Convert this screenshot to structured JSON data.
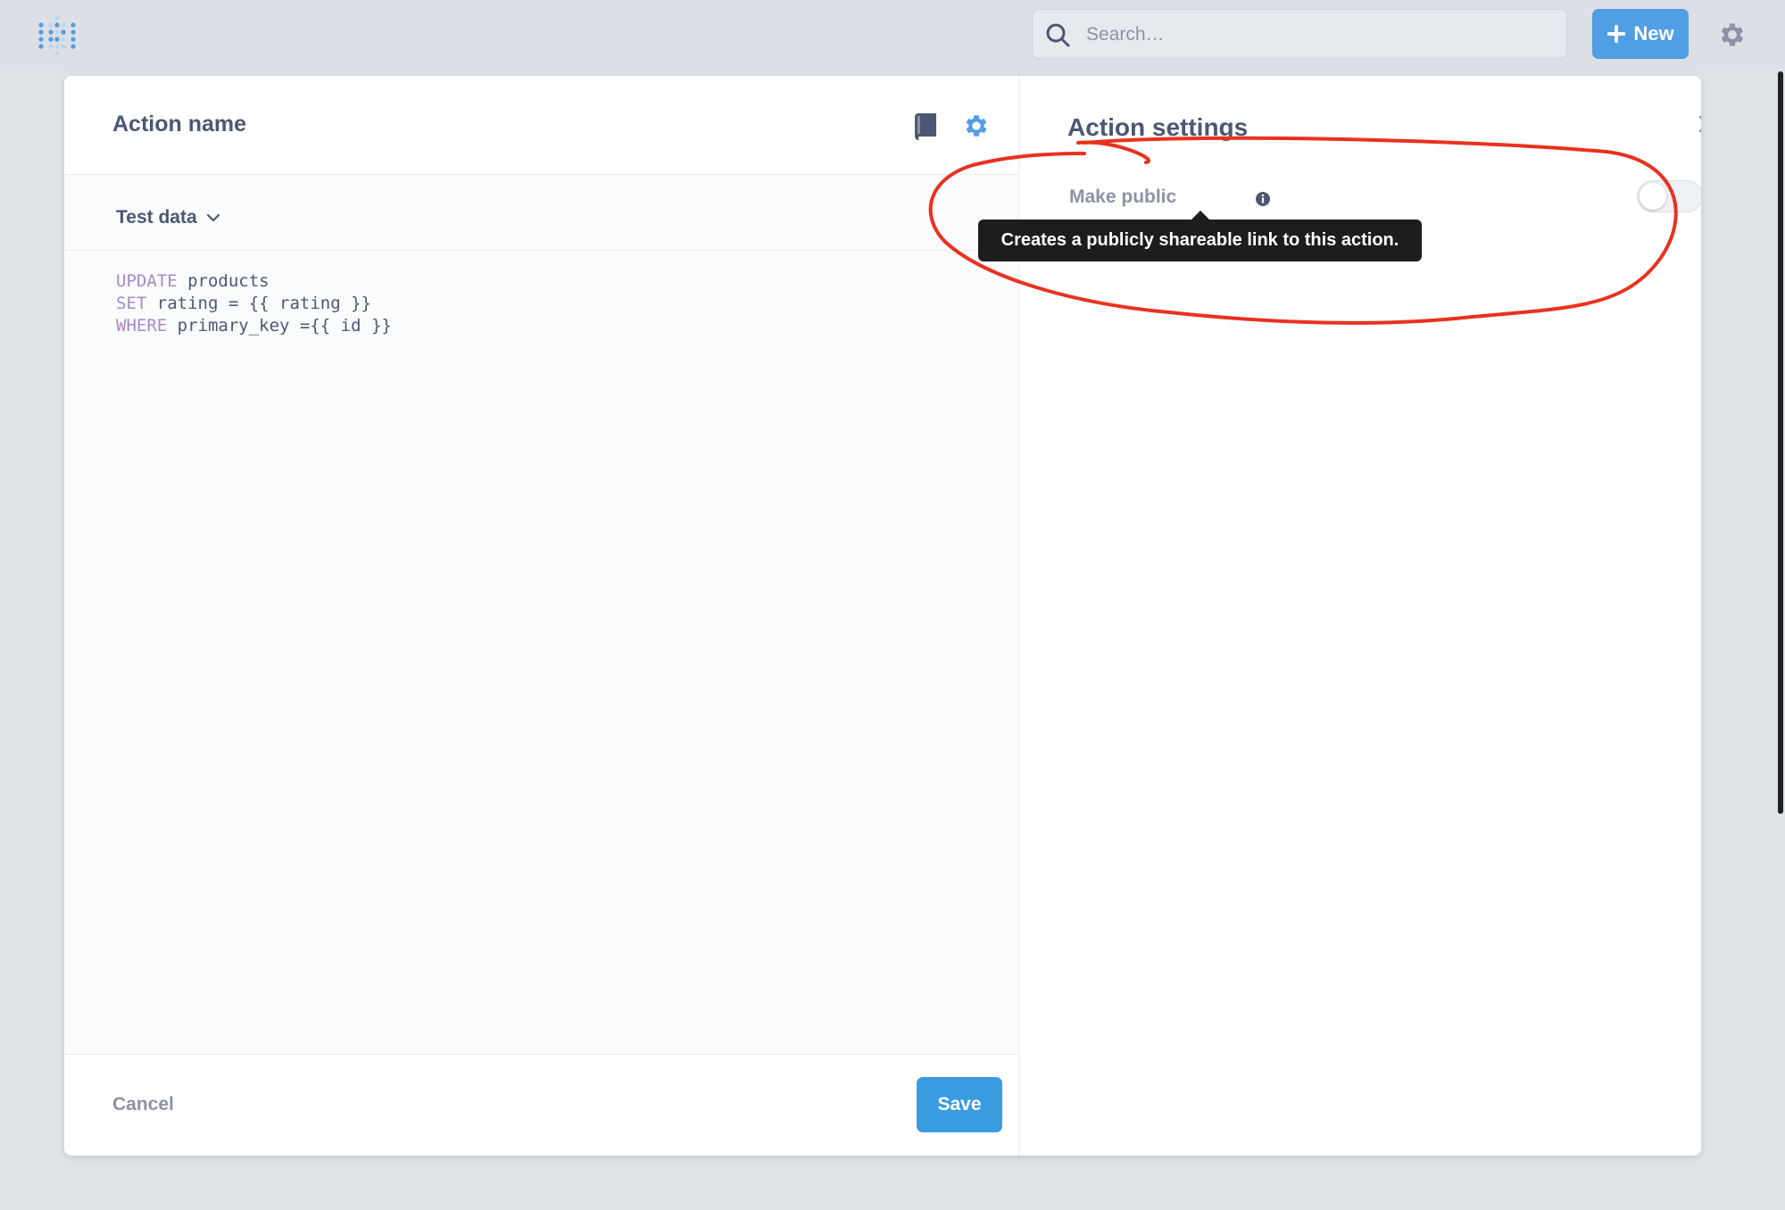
{
  "topbar": {
    "search_placeholder": "Search…",
    "new_label": "New"
  },
  "editor": {
    "action_name": "Action name",
    "test_data_label": "Test data",
    "code": [
      {
        "kw": "UPDATE",
        "rest": " products"
      },
      {
        "kw": "SET",
        "rest": " rating = {{ rating }}"
      },
      {
        "kw": "WHERE",
        "rest": " primary_key ={{ id }}"
      }
    ],
    "cancel_label": "Cancel",
    "save_label": "Save"
  },
  "settings": {
    "title": "Action settings",
    "make_public_label": "Make public",
    "make_public_enabled": false,
    "tooltip": "Creates a publicly shareable link to this action."
  },
  "colors": {
    "accent": "#509ee3",
    "save": "#3b9be0",
    "keyword": "#a989c5",
    "annotation": "#e8321f"
  }
}
